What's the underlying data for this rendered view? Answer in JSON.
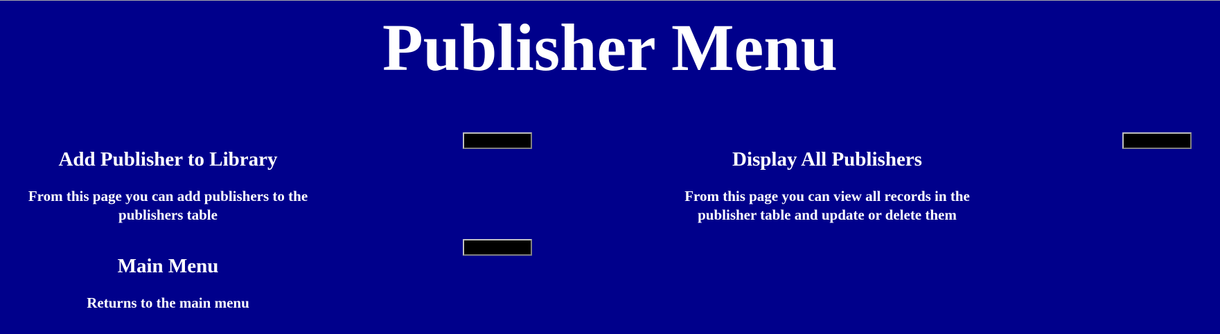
{
  "page": {
    "title": "Publisher Menu",
    "background_color": "#00008b",
    "text_color": "#ffffff",
    "button_color": "#000000"
  },
  "options": [
    {
      "title": "Add Publisher to Library",
      "description": "From this page you can add publishers to the publishers table",
      "button_label": ""
    },
    {
      "title": "Display All Publishers",
      "description": "From this page you can view all records in the publisher table and update or delete them",
      "button_label": ""
    },
    {
      "title": "Main Menu",
      "description": "Returns to the main menu",
      "button_label": ""
    }
  ]
}
